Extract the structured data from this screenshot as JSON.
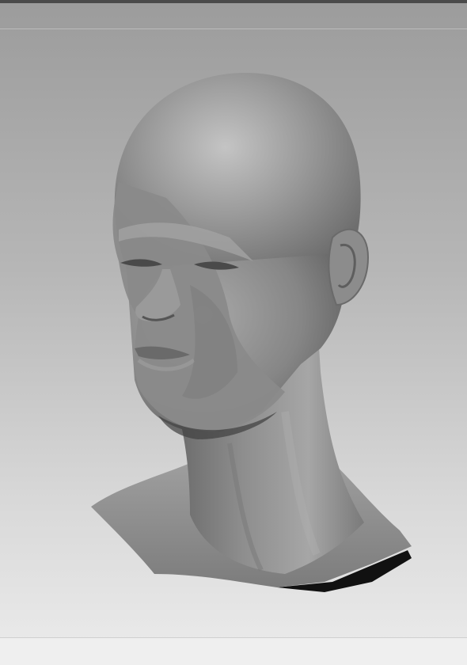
{
  "canvas": {
    "background_top": "#9c9c9c",
    "background_bottom": "#ececec",
    "material_color": "#8f8f8f"
  },
  "model": {
    "icon": "sculpted-head-bust"
  }
}
